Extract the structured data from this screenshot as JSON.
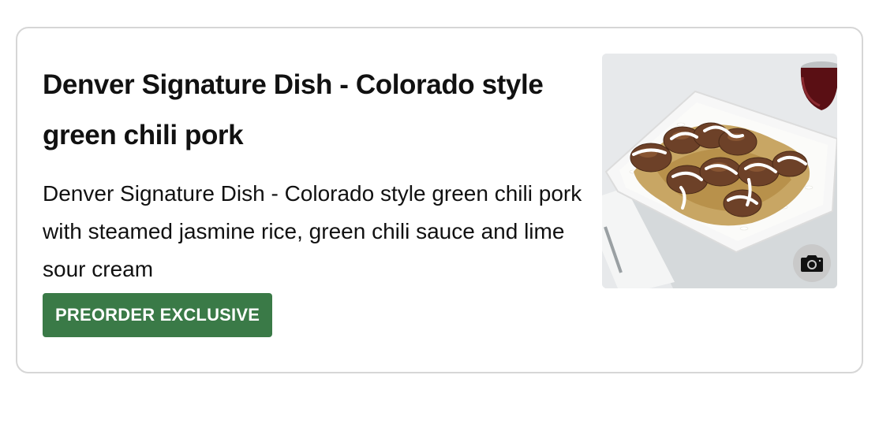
{
  "menu_item": {
    "title": "Denver Signature Dish - Colorado style green chili pork",
    "description": "Denver Signature Dish - Colorado style green chili pork with steamed jasmine rice, green chili sauce and lime sour cream",
    "badge_label": "PREORDER EXCLUSIVE",
    "badge_color": "#3a7a47",
    "photo_icon": "camera-icon"
  }
}
